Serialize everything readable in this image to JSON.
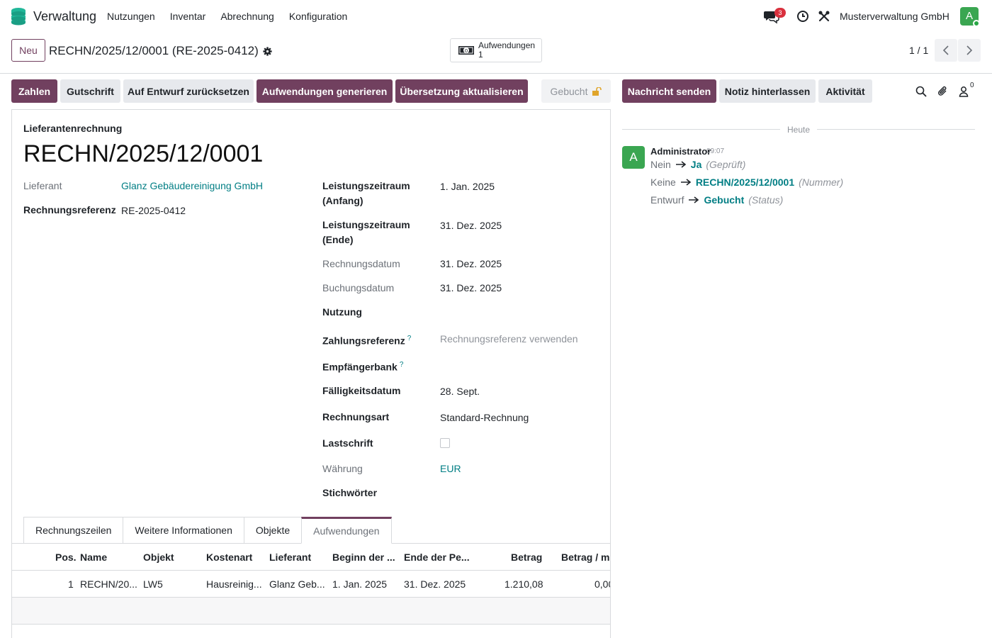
{
  "nav": {
    "app_name": "Verwaltung",
    "menu": [
      "Nutzungen",
      "Inventar",
      "Abrechnung",
      "Konfiguration"
    ],
    "chat_badge": "3",
    "company": "Musterverwaltung GmbH",
    "avatar_letter": "A",
    "brand_color": "#71405f"
  },
  "control": {
    "new_label": "Neu",
    "breadcrumb": "RECHN/2025/12/0001 (RE-2025-0412)",
    "smart_label": "Aufwendungen",
    "smart_count": "1",
    "pager": "1 / 1"
  },
  "status_buttons": {
    "pay": "Zahlen",
    "credit": "Gutschrift",
    "reset": "Auf Entwurf zurücksetzen",
    "generate": "Aufwendungen generieren",
    "translate": "Übersetzung aktualisieren",
    "booked": "Gebucht"
  },
  "chatter_buttons": {
    "send": "Nachricht senden",
    "note": "Notiz hinterlassen",
    "activity": "Aktivität",
    "followers": "0"
  },
  "form": {
    "doc_type": "Lieferantenrechnung",
    "title": "RECHN/2025/12/0001",
    "left": {
      "vendor_label": "Lieferant",
      "vendor_value": "Glanz Gebäudereinigung GmbH",
      "ref_label": "Rechnungsreferenz",
      "ref_value": "RE-2025-0412"
    },
    "right": {
      "period_start_label": "Leistungszeitraum (Anfang)",
      "period_start_value": "1. Jan. 2025",
      "period_end_label": "Leistungszeitraum (Ende)",
      "period_end_value": "31. Dez. 2025",
      "invoice_date_label": "Rechnungsdatum",
      "invoice_date_value": "31. Dez. 2025",
      "booking_date_label": "Buchungsdatum",
      "booking_date_value": "31. Dez. 2025",
      "usage_label": "Nutzung",
      "payref_label": "Zahlungsreferenz",
      "payref_placeholder": "Rechnungsreferenz verwenden",
      "bank_label": "Empfängerbank",
      "due_label": "Fälligkeitsdatum",
      "due_value": "28. Sept.",
      "type_label": "Rechnungsart",
      "type_value": "Standard-Rechnung",
      "debit_label": "Lastschrift",
      "currency_label": "Währung",
      "currency_value": "EUR",
      "tags_label": "Stichwörter",
      "help_mark": "?"
    }
  },
  "tabs": [
    "Rechnungszeilen",
    "Weitere Informationen",
    "Objekte",
    "Aufwendungen"
  ],
  "table": {
    "headers": [
      "Pos.",
      "Name",
      "Objekt",
      "Kostenart",
      "Lieferant",
      "Beginn der ...",
      "Ende der Pe...",
      "Betrag",
      "Betrag / m"
    ],
    "rows": [
      [
        "1",
        "RECHN/20...",
        "LW5",
        "Hausreinig...",
        "Glanz Geb...",
        "1. Jan. 2025",
        "31. Dez. 2025",
        "1.210,08",
        "0,00"
      ]
    ]
  },
  "chatter": {
    "divider": "Heute",
    "author": "Administrator",
    "time": "09:07",
    "avatar_letter": "A",
    "changes": [
      {
        "old": "Nein",
        "new": "Ja",
        "field": "(Geprüft)"
      },
      {
        "old": "Keine",
        "new": "RECHN/2025/12/0001",
        "field": "(Nummer)"
      },
      {
        "old": "Entwurf",
        "new": "Gebucht",
        "field": "(Status)"
      }
    ]
  }
}
